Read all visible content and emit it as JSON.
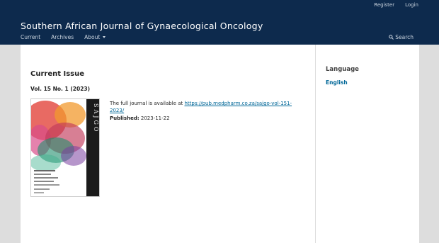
{
  "header": {
    "user_nav": {
      "register": "Register",
      "login": "Login"
    },
    "site_title": "Southern African Journal of Gynaecological Oncology",
    "primary_nav": [
      {
        "label": "Current"
      },
      {
        "label": "Archives"
      },
      {
        "label": "About"
      }
    ],
    "search_label": "Search"
  },
  "main": {
    "heading": "Current Issue",
    "issue_title": "Vol. 15 No. 1 (2023)",
    "cover_spine_text": "SAJGO",
    "description_prefix": "The full journal is available at ",
    "description_link": "https://pub.medpharm.co.za/sajgo-vol-151-2023/",
    "published_label": "Published:",
    "published_date": "2023-11-22"
  },
  "sidebar": {
    "language_title": "Language",
    "language_item": "English"
  },
  "colors": {
    "header_bg": "#0d2a4d",
    "link": "#006798",
    "page_bg": "#dddddd"
  }
}
